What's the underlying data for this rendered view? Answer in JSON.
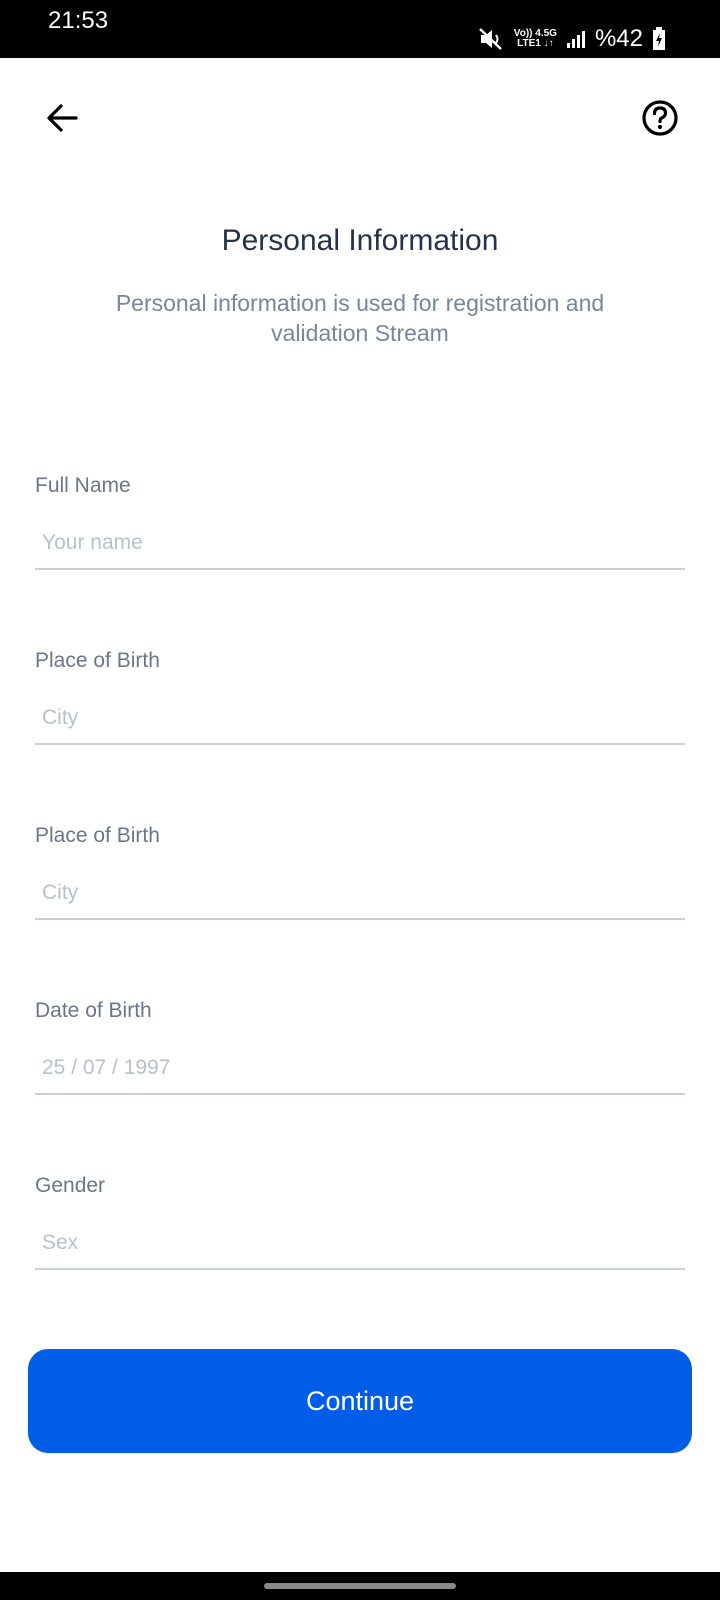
{
  "status_bar": {
    "time": "21:53",
    "network_top": "Vo)) 4.5G",
    "network_bottom": "LTE1 ↓↑",
    "battery": "%42",
    "icons": [
      "mute-icon",
      "signal-icon",
      "battery-charging-icon"
    ]
  },
  "header": {
    "back_icon": "arrow-left-icon",
    "help_icon": "question-circle-icon"
  },
  "page": {
    "title": "Personal Information",
    "subtitle": "Personal information is used for registration and validation Stream"
  },
  "form": {
    "fields": [
      {
        "label": "Full Name",
        "placeholder": "Your name",
        "value": ""
      },
      {
        "label": "Place of Birth",
        "placeholder": "City",
        "value": ""
      },
      {
        "label": "Place of Birth",
        "placeholder": "City",
        "value": ""
      },
      {
        "label": "Date of Birth",
        "placeholder": "25 / 07 / 1997",
        "value": ""
      },
      {
        "label": "Gender",
        "placeholder": "Sex",
        "value": ""
      }
    ],
    "continue_label": "Continue"
  },
  "colors": {
    "primary": "#005de8",
    "title": "#25324a",
    "subtitle": "#7a8597",
    "label": "#6b7688",
    "placeholder": "#b8c0ca",
    "divider": "#c9d0d8"
  }
}
